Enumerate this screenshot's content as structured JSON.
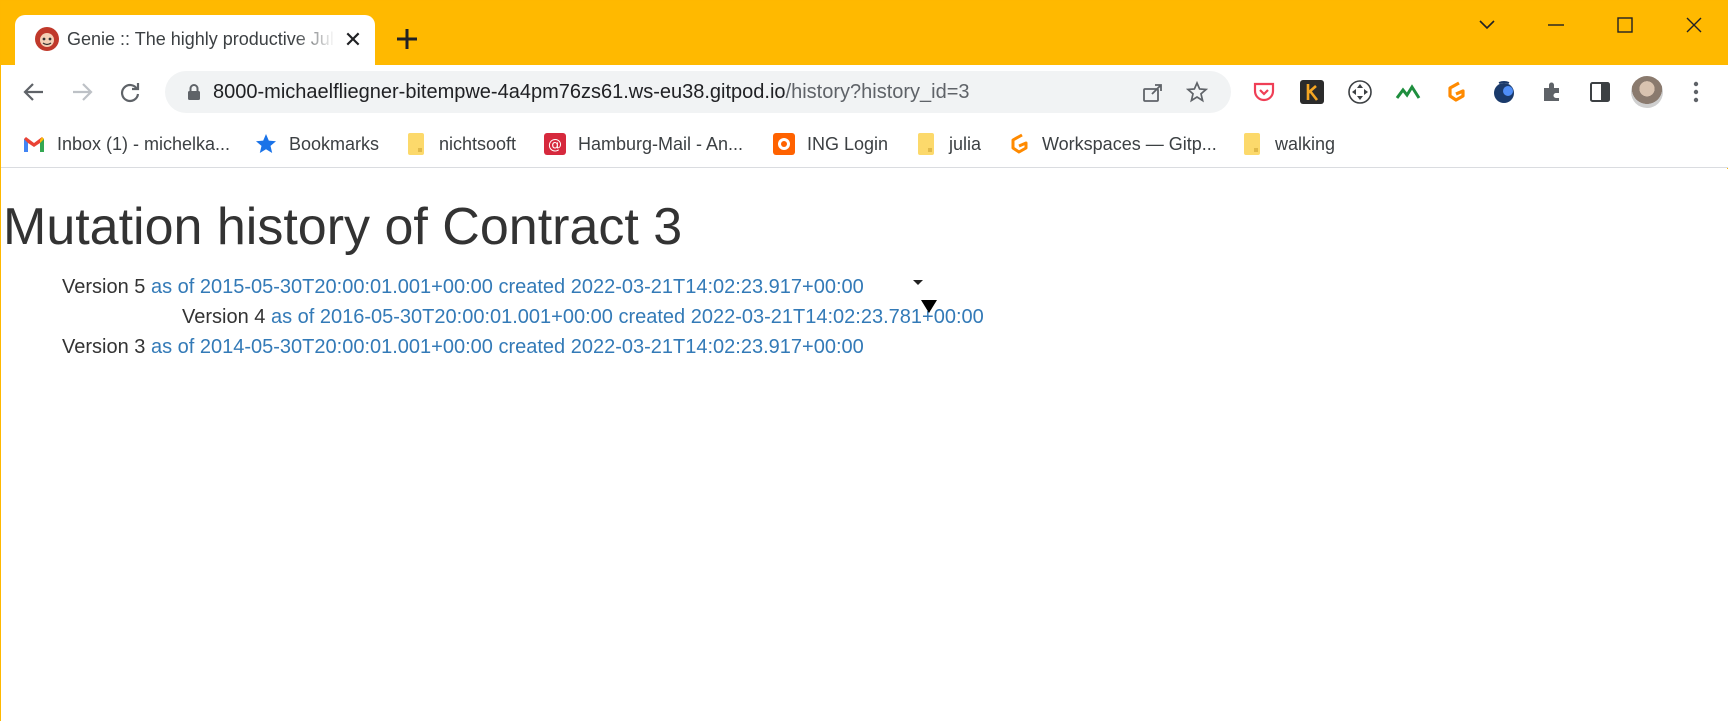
{
  "browser": {
    "tab": {
      "title": "Genie :: The highly productive Julia web framework",
      "close_glyph": "✕"
    },
    "new_tab_glyph": "+",
    "url": {
      "host": "8000-michaelfliegner-bitempwe-4a4pm76zs61.ws-eu38.gitpod.io",
      "path": "/history?history_id=3"
    },
    "bookmarks": [
      {
        "label": "Inbox (1) - michelka...",
        "icon": "gmail-icon"
      },
      {
        "label": "Bookmarks",
        "icon": "star-icon"
      },
      {
        "label": "nichtsooft",
        "icon": "folder-icon"
      },
      {
        "label": "Hamburg-Mail - An...",
        "icon": "mail-at-icon"
      },
      {
        "label": "ING Login",
        "icon": "ing-lion-icon"
      },
      {
        "label": "julia",
        "icon": "folder-icon"
      },
      {
        "label": "Workspaces — Gitp...",
        "icon": "gitpod-icon"
      },
      {
        "label": "walking",
        "icon": "folder-icon"
      }
    ],
    "colors": {
      "titlebar": "#ffb900",
      "link": "#337ab7",
      "text": "#333333"
    }
  },
  "page": {
    "title": "Mutation history of Contract 3",
    "versions": [
      {
        "label": "Version 5",
        "link": "as of 2015-05-30T20:00:01.001+00:00 created 2022-03-21T14:02:23.917+00:00",
        "expanded": true
      },
      {
        "label": "Version 4",
        "link": "as of 2016-05-30T20:00:01.001+00:00 created 2022-03-21T14:02:23.781+00:00"
      },
      {
        "label": "Version 3",
        "link": "as of 2014-05-30T20:00:01.001+00:00 created 2022-03-21T14:02:23.917+00:00"
      }
    ]
  }
}
